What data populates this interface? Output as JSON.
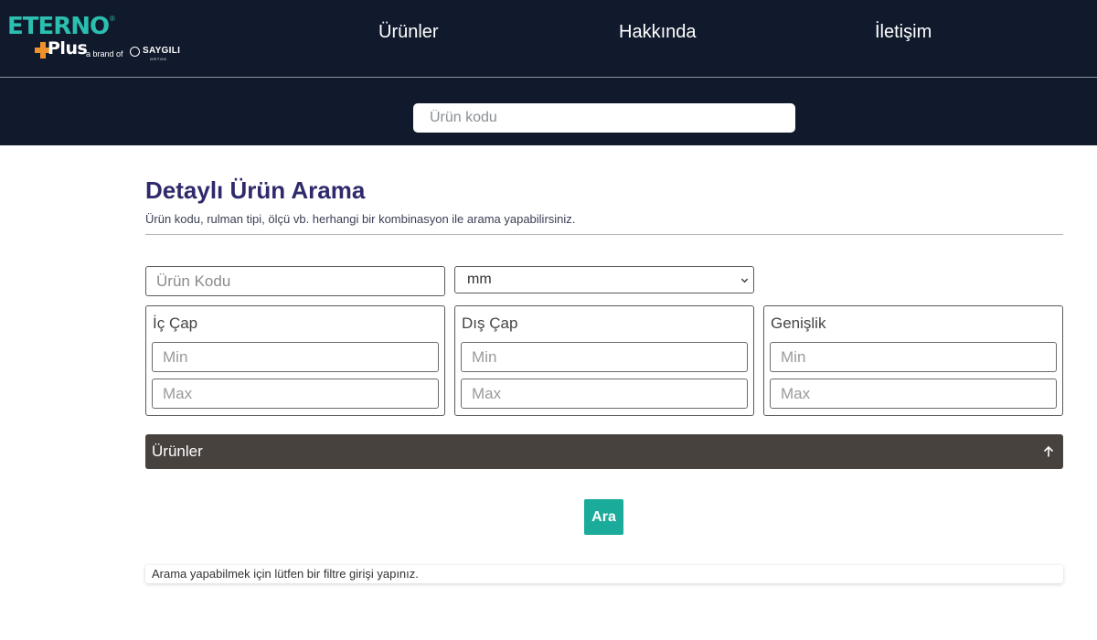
{
  "header": {
    "logo": {
      "wordmark": "ETERNO",
      "registered": "®",
      "plus": "Plus",
      "brand_of": "a brand of",
      "parent_brand": "SAYGILI",
      "parent_sub": "ORTOK"
    },
    "nav": [
      {
        "label": "Ürünler"
      },
      {
        "label": "Hakkında"
      },
      {
        "label": "İletişim"
      }
    ],
    "search": {
      "placeholder": "Ürün kodu",
      "value": ""
    }
  },
  "main": {
    "title": "Detaylı Ürün Arama",
    "subtitle": "Ürün kodu, rulman tipi, ölçü vb. herhangi bir kombinasyon ile arama yapabilirsiniz.",
    "code_input": {
      "placeholder": "Ürün Kodu",
      "value": ""
    },
    "unit_select": {
      "selected": "mm"
    },
    "ranges": [
      {
        "label": "İç Çap",
        "min_placeholder": "Min",
        "max_placeholder": "Max"
      },
      {
        "label": "Dış Çap",
        "min_placeholder": "Min",
        "max_placeholder": "Max"
      },
      {
        "label": "Genişlik",
        "min_placeholder": "Min",
        "max_placeholder": "Max"
      }
    ],
    "products_bar": {
      "label": "Ürünler",
      "icon": "arrow-up-icon"
    },
    "search_button": {
      "label": "Ara"
    },
    "info_message": "Arama yapabilmek için lütfen bir filtre girişi yapınız."
  },
  "colors": {
    "header_bg": "#111a2c",
    "title": "#2e2a6b",
    "accent": "#1aab9a",
    "bar_bg": "#48423f",
    "logo_teal": "#2cbfb0",
    "logo_orange": "#f0922b"
  }
}
